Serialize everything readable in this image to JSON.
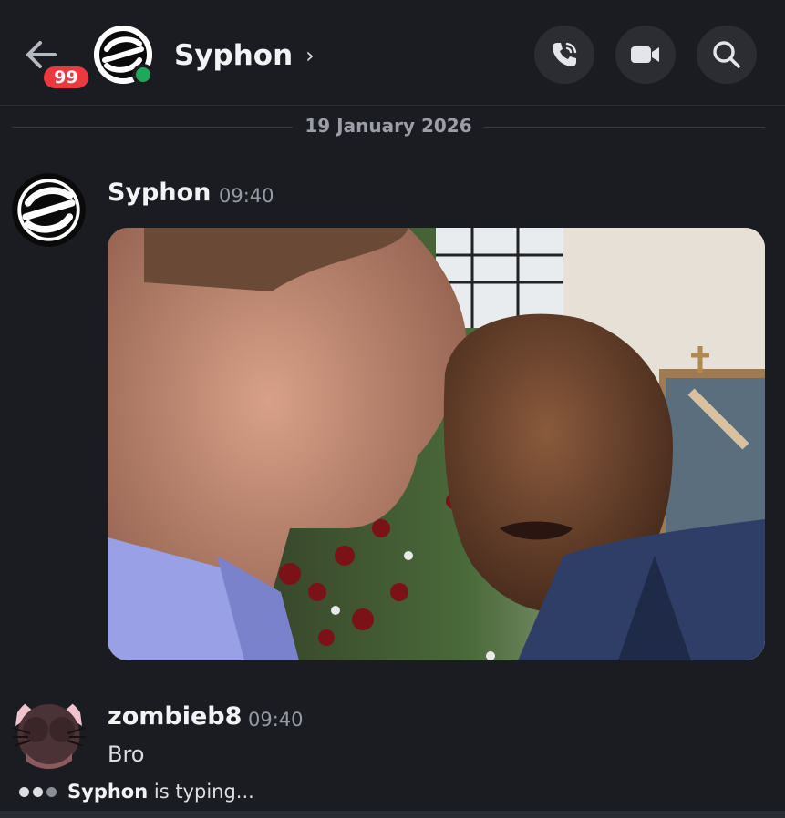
{
  "header": {
    "unread_count": "99",
    "channel_name": "Syphon",
    "chevron": "›",
    "icons": [
      "back-arrow-icon",
      "phone-call-icon",
      "video-camera-icon",
      "search-icon"
    ],
    "presence_color": "#23a55a"
  },
  "divider": {
    "date": "19 January 2026"
  },
  "messages": [
    {
      "author": "Syphon",
      "time": "09:40",
      "attachment": "image"
    },
    {
      "author": "zombieb8",
      "time": "09:40",
      "text": "Bro"
    }
  ],
  "typing": {
    "user": "Syphon",
    "suffix": "is typing..."
  },
  "colors": {
    "background": "#1b1c21",
    "badge": "#e83a3f",
    "button_bg": "#2b2d33"
  }
}
